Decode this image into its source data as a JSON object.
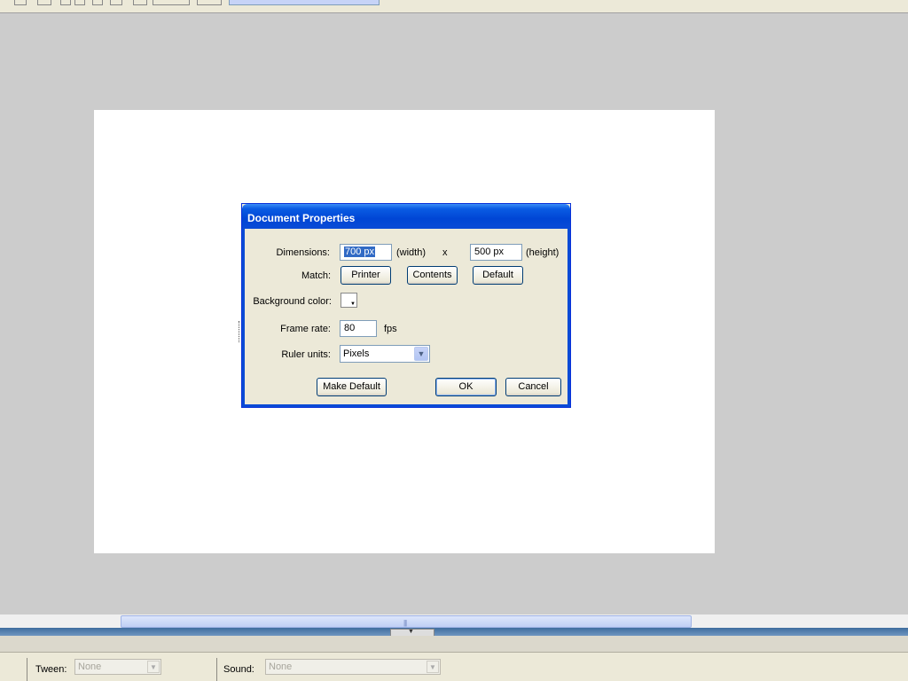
{
  "dialog": {
    "title": "Document Properties",
    "dimensions_label": "Dimensions:",
    "width_value": "700 px",
    "width_suffix": "(width)",
    "times": "x",
    "height_value": "500 px",
    "height_suffix": "(height)",
    "match_label": "Match:",
    "match_buttons": [
      "Printer",
      "Contents",
      "Default"
    ],
    "background_label": "Background color:",
    "background_color": "#ffffff",
    "frame_rate_label": "Frame rate:",
    "frame_rate_value": "80",
    "fps_label": "fps",
    "ruler_label": "Ruler units:",
    "ruler_value": "Pixels",
    "make_default_label": "Make Default",
    "ok_label": "OK",
    "cancel_label": "Cancel"
  },
  "properties": {
    "tween_label": "Tween:",
    "tween_value": "None",
    "sound_label": "Sound:",
    "sound_value": "None"
  },
  "colors": {
    "titlebar": "#0a4bd6",
    "stage": "#ffffff",
    "workarea": "#cccccc"
  }
}
